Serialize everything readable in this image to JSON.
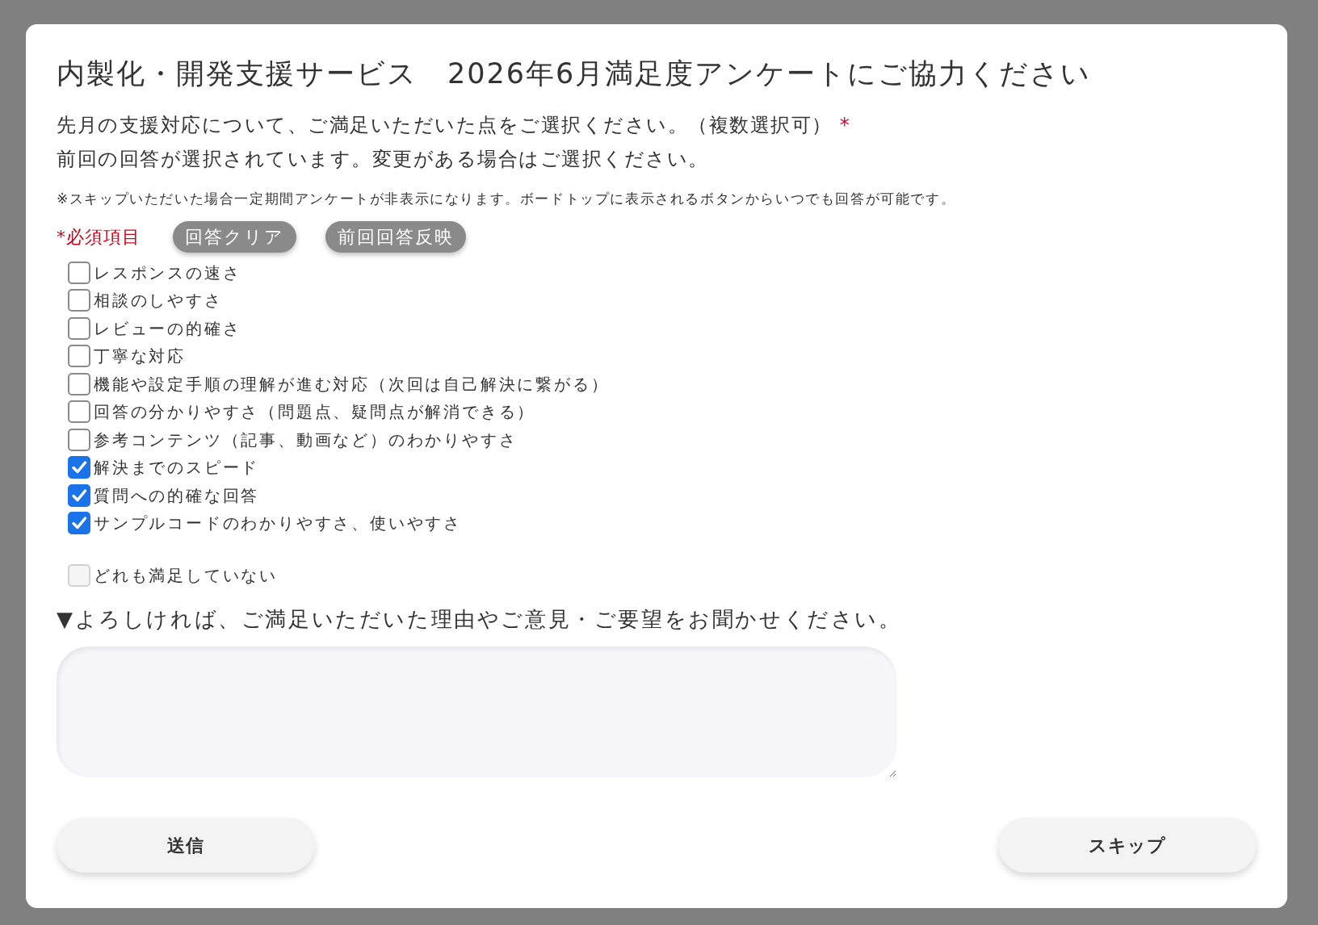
{
  "dialog": {
    "title": "内製化・開発支援サービス　2026年6月満足度アンケートにご協力ください",
    "question": "先月の支援対応について、ご満足いただいた点をご選択ください。（複数選択可）",
    "required_mark": "*",
    "previous_note": "前回の回答が選択されています。変更がある場合はご選択ください。",
    "skip_note": "※スキップいただいた場合一定期間アンケートが非表示になります。ボードトップに表示されるボタンからいつでも回答が可能です。",
    "required_label": "*必須項目",
    "tool_buttons": [
      "回答クリア",
      "前回回答反映"
    ],
    "options": [
      {
        "label": "レスポンスの速さ",
        "checked": false,
        "disabled": false
      },
      {
        "label": "相談のしやすさ",
        "checked": false,
        "disabled": false
      },
      {
        "label": "レビューの的確さ",
        "checked": false,
        "disabled": false
      },
      {
        "label": "丁寧な対応",
        "checked": false,
        "disabled": false
      },
      {
        "label": "機能や設定手順の理解が進む対応（次回は自己解決に繋がる）",
        "checked": false,
        "disabled": false
      },
      {
        "label": "回答の分かりやすさ（問題点、疑問点が解消できる）",
        "checked": false,
        "disabled": false
      },
      {
        "label": "参考コンテンツ（記事、動画など）のわかりやすさ",
        "checked": false,
        "disabled": false
      },
      {
        "label": "解決までのスピード",
        "checked": true,
        "disabled": false
      },
      {
        "label": "質問への的確な回答",
        "checked": true,
        "disabled": false
      },
      {
        "label": "サンプルコードのわかりやすさ、使いやすさ",
        "checked": true,
        "disabled": false
      }
    ],
    "none_option": {
      "label": "どれも満足していない",
      "checked": false,
      "disabled": true
    },
    "comment_prompt": "▼よろしければ、ご満足いただいた理由やご意見・ご要望をお聞かせください。",
    "submit": "送信",
    "skip": "スキップ"
  }
}
